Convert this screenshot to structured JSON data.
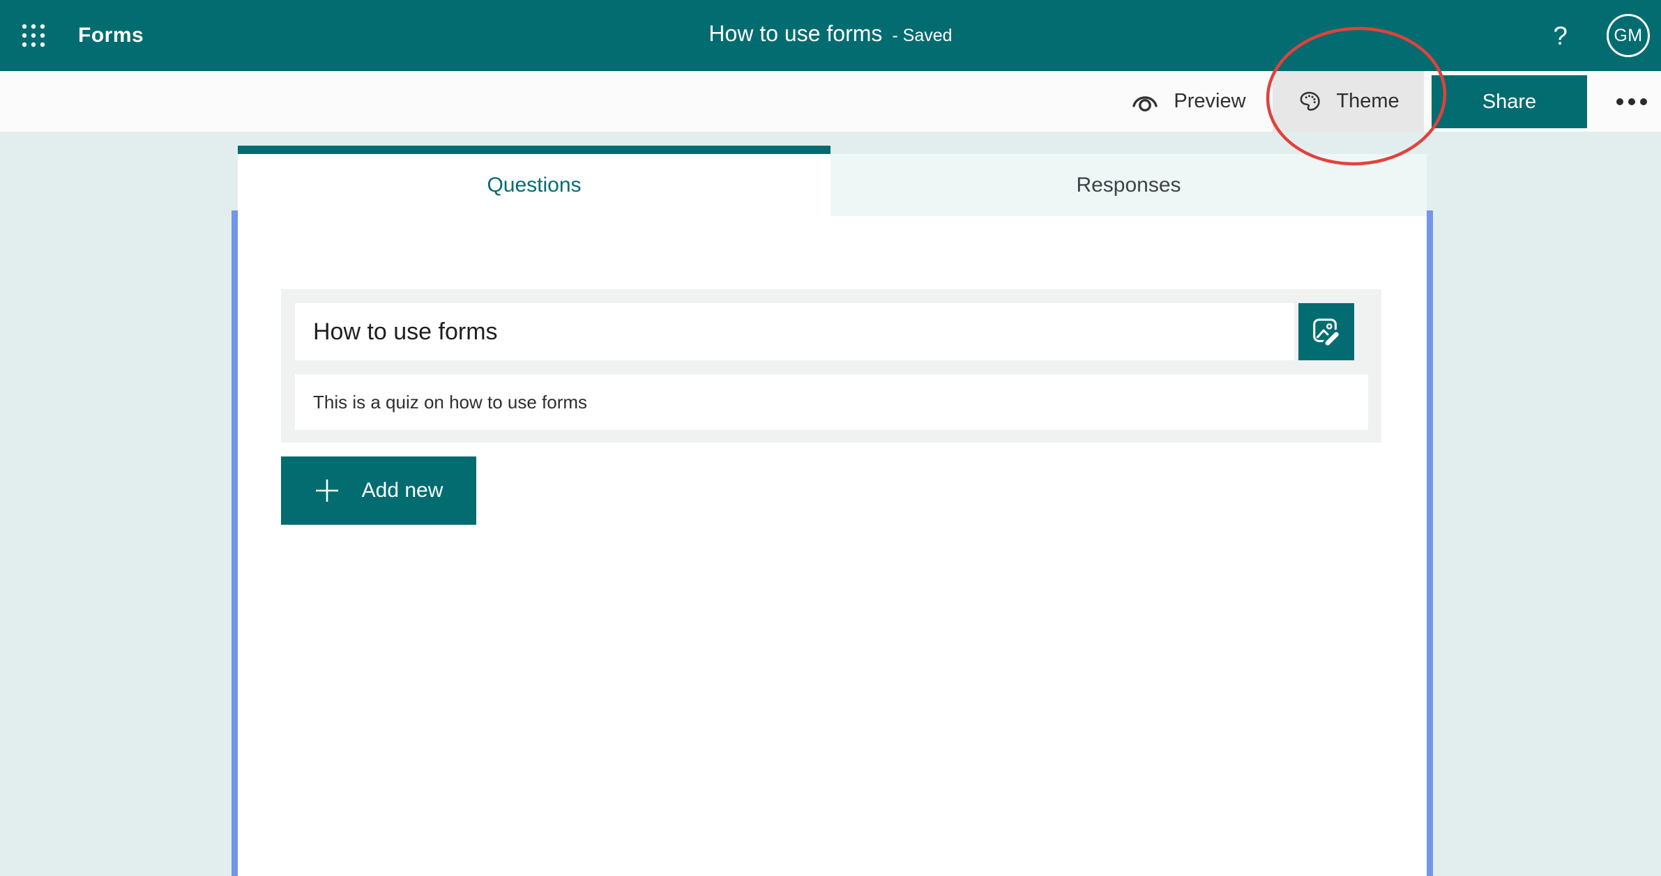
{
  "header": {
    "app_name": "Forms",
    "doc_title": "How to use forms",
    "doc_status": "- Saved",
    "help_label": "?",
    "avatar_initials": "GM"
  },
  "toolbar": {
    "preview_label": "Preview",
    "theme_label": "Theme",
    "share_label": "Share"
  },
  "tabs": {
    "questions_label": "Questions",
    "responses_label": "Responses",
    "active_tab": "Questions"
  },
  "form": {
    "title": "How to use forms",
    "description": "This is a quiz on how to use forms",
    "add_new_label": "Add new"
  },
  "icons": {
    "app_launcher": "waffle-icon",
    "preview": "eye-icon",
    "theme": "palette-icon",
    "more": "ellipsis-icon",
    "title_image": "image-edit-icon",
    "add_new": "plus-icon"
  },
  "colors": {
    "teal": "#036c70",
    "page_bg": "#e2eeee",
    "toolbar_bg": "#fbfbfb",
    "theme_button_hover_bg": "#e7e7e7",
    "responses_tab_bg": "#eff6f6",
    "card_bg": "#f0f1f1",
    "accent_line_blue": "#7396e5",
    "annotation_red": "#e2413c"
  },
  "annotation": {
    "type": "ellipse",
    "around": "Theme button"
  }
}
